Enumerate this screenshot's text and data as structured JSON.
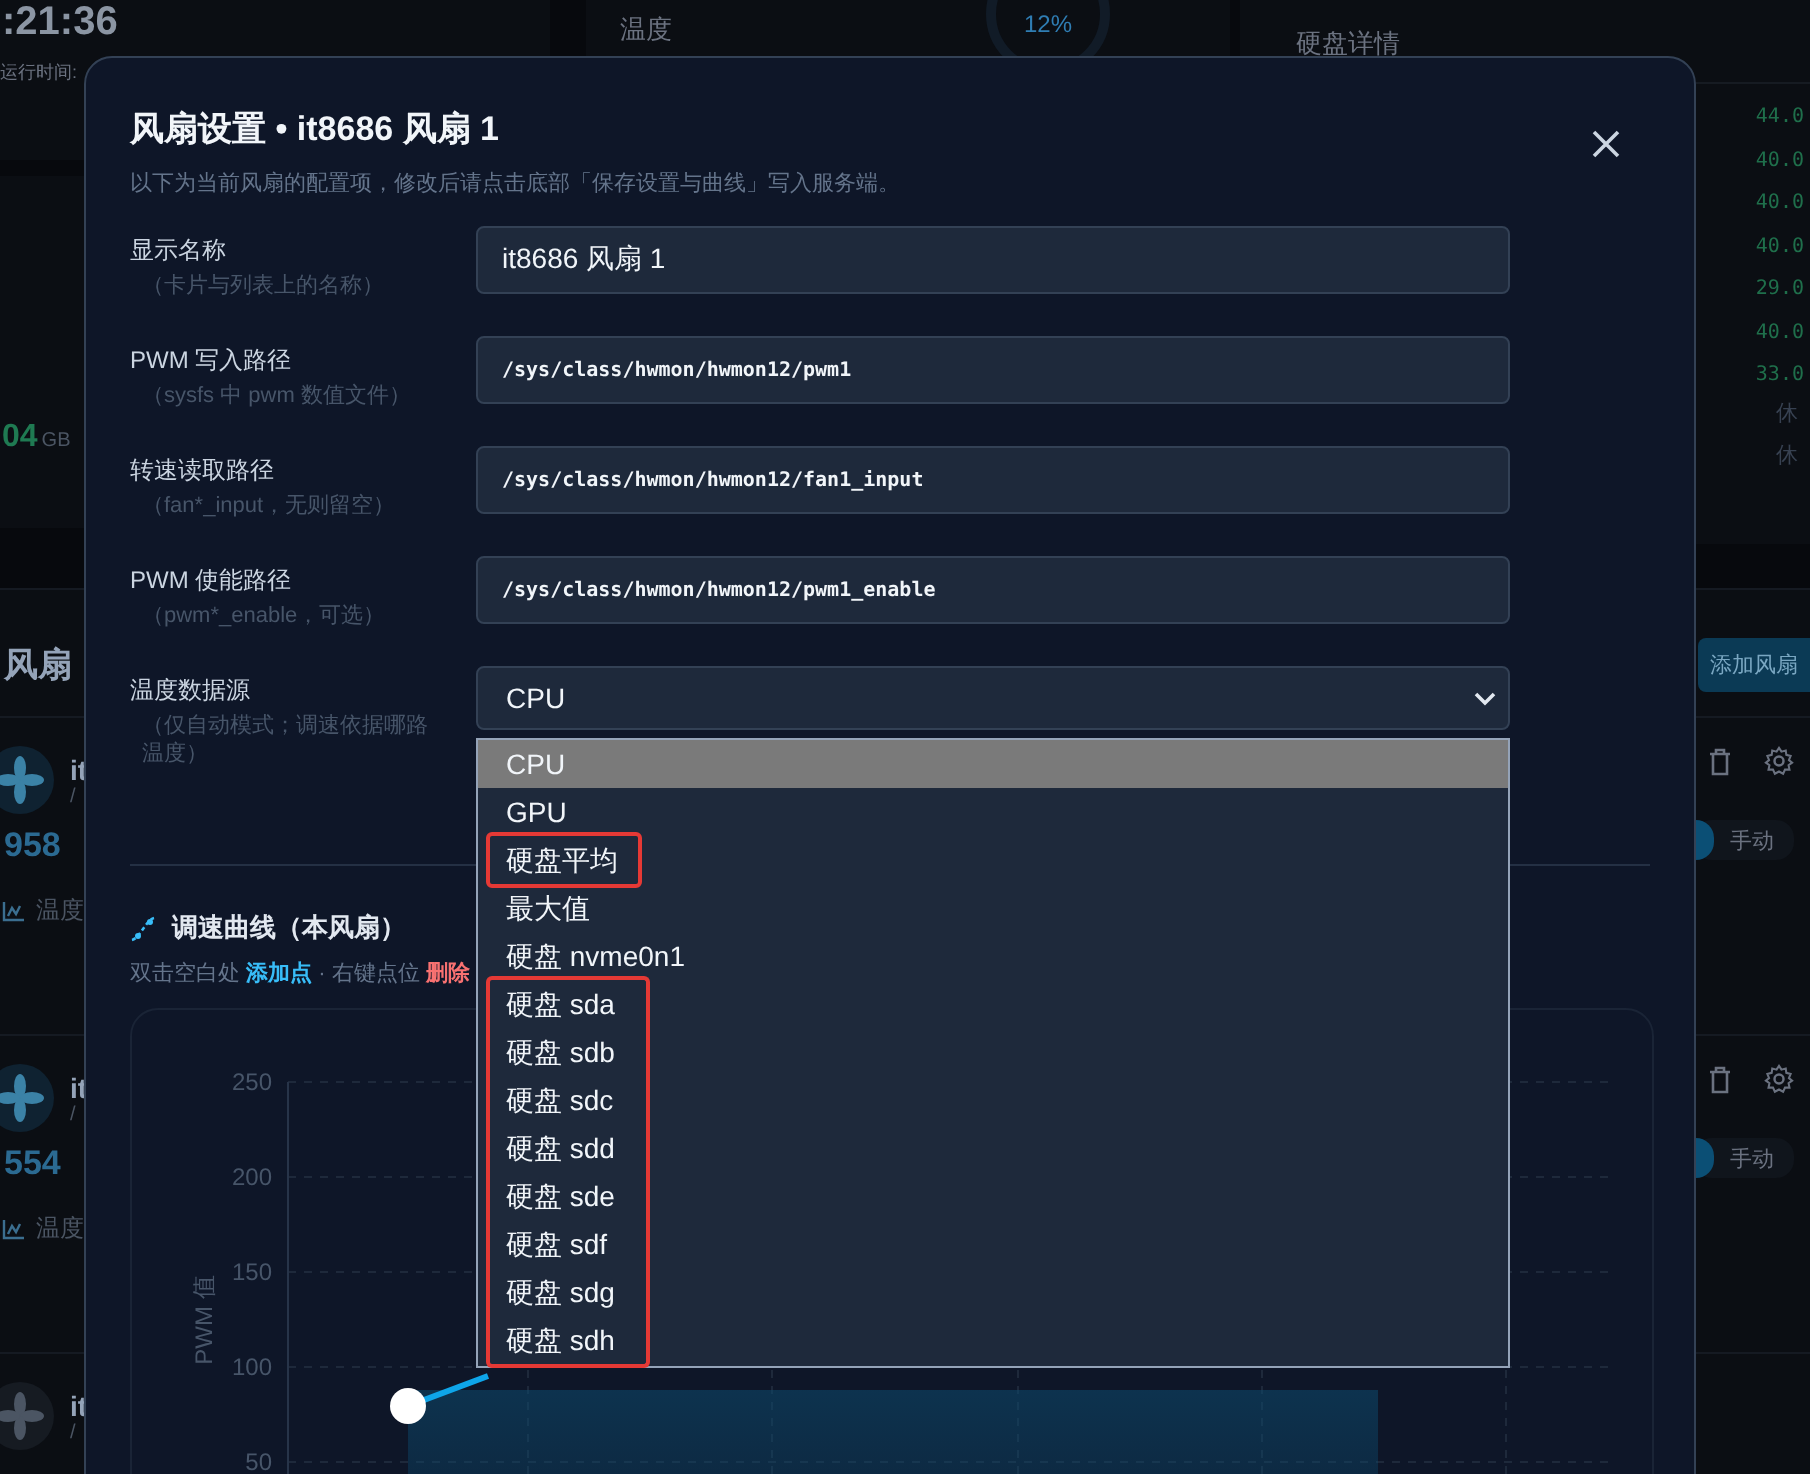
{
  "background": {
    "clock": ":21:36",
    "uptime_label": "运行时间:",
    "memory_value": "04",
    "memory_unit": "GB",
    "temperature_label": "温度",
    "gauge_reading": "12%",
    "disk_details_title": "硬盘详情",
    "disk_temps": [
      "44.0",
      "40.0",
      "40.0",
      "40.0",
      "29.0",
      "40.0",
      "33.0"
    ],
    "disk_states": [
      "休",
      "休"
    ],
    "fan_panel_title": "风扇",
    "add_fan_button": "添加风扇",
    "fans": [
      {
        "name": "it",
        "path": "/",
        "rpm": "958",
        "temp_label": "温度",
        "mode": "手动",
        "auto": true,
        "enabled": true
      },
      {
        "name": "it",
        "path": "/",
        "rpm": "554",
        "temp_label": "温度",
        "mode": "手动",
        "auto": true,
        "enabled": true
      },
      {
        "name": "it",
        "path": "/",
        "enabled": false
      }
    ]
  },
  "modal": {
    "title": "风扇设置 • it8686 风扇 1",
    "subtitle": "以下为当前风扇的配置项，修改后请点击底部「保存设置与曲线」写入服务端。",
    "fields": [
      {
        "label": "显示名称",
        "hint": "（卡片与列表上的名称）",
        "value": "it8686 风扇 1",
        "kind": "text"
      },
      {
        "label": "PWM 写入路径",
        "hint": "（sysfs 中 pwm 数值文件）",
        "value": "/sys/class/hwmon/hwmon12/pwm1",
        "kind": "path"
      },
      {
        "label": "转速读取路径",
        "hint": "（fan*_input，无则留空）",
        "value": "/sys/class/hwmon/hwmon12/fan1_input",
        "kind": "path"
      },
      {
        "label": "PWM 使能路径",
        "hint": "（pwm*_enable，可选）",
        "value": "/sys/class/hwmon/hwmon12/pwm1_enable",
        "kind": "path"
      },
      {
        "label": "温度数据源",
        "hint": "（仅自动模式；调速依据哪路温度）",
        "value": "CPU",
        "kind": "select"
      }
    ],
    "dropdown": [
      {
        "label": "CPU",
        "selected": true,
        "outlined": false
      },
      {
        "label": "GPU",
        "selected": false,
        "outlined": false
      },
      {
        "label": "硬盘平均",
        "selected": false,
        "outlined": true
      },
      {
        "label": "最大值",
        "selected": false,
        "outlined": false
      },
      {
        "label": "硬盘 nvme0n1",
        "selected": false,
        "outlined": false
      },
      {
        "label": "硬盘 sda",
        "selected": false,
        "outlined": true
      },
      {
        "label": "硬盘 sdb",
        "selected": false,
        "outlined": true
      },
      {
        "label": "硬盘 sdc",
        "selected": false,
        "outlined": true
      },
      {
        "label": "硬盘 sdd",
        "selected": false,
        "outlined": true
      },
      {
        "label": "硬盘 sde",
        "selected": false,
        "outlined": true
      },
      {
        "label": "硬盘 sdf",
        "selected": false,
        "outlined": true
      },
      {
        "label": "硬盘 sdg",
        "selected": false,
        "outlined": true
      },
      {
        "label": "硬盘 sdh",
        "selected": false,
        "outlined": true
      }
    ],
    "curve_title": "调速曲线（本风扇）",
    "curve_hint": [
      {
        "text": "双击空白处 ",
        "kind": "plain"
      },
      {
        "text": "添加点",
        "kind": "add"
      },
      {
        "text": " · 右键点位 ",
        "kind": "plain"
      },
      {
        "text": "删除",
        "kind": "remove"
      }
    ],
    "curve_chart": {
      "ylabel": "PWM 值",
      "yticks": [
        "250",
        "200",
        "150",
        "100",
        "50"
      ]
    }
  }
}
